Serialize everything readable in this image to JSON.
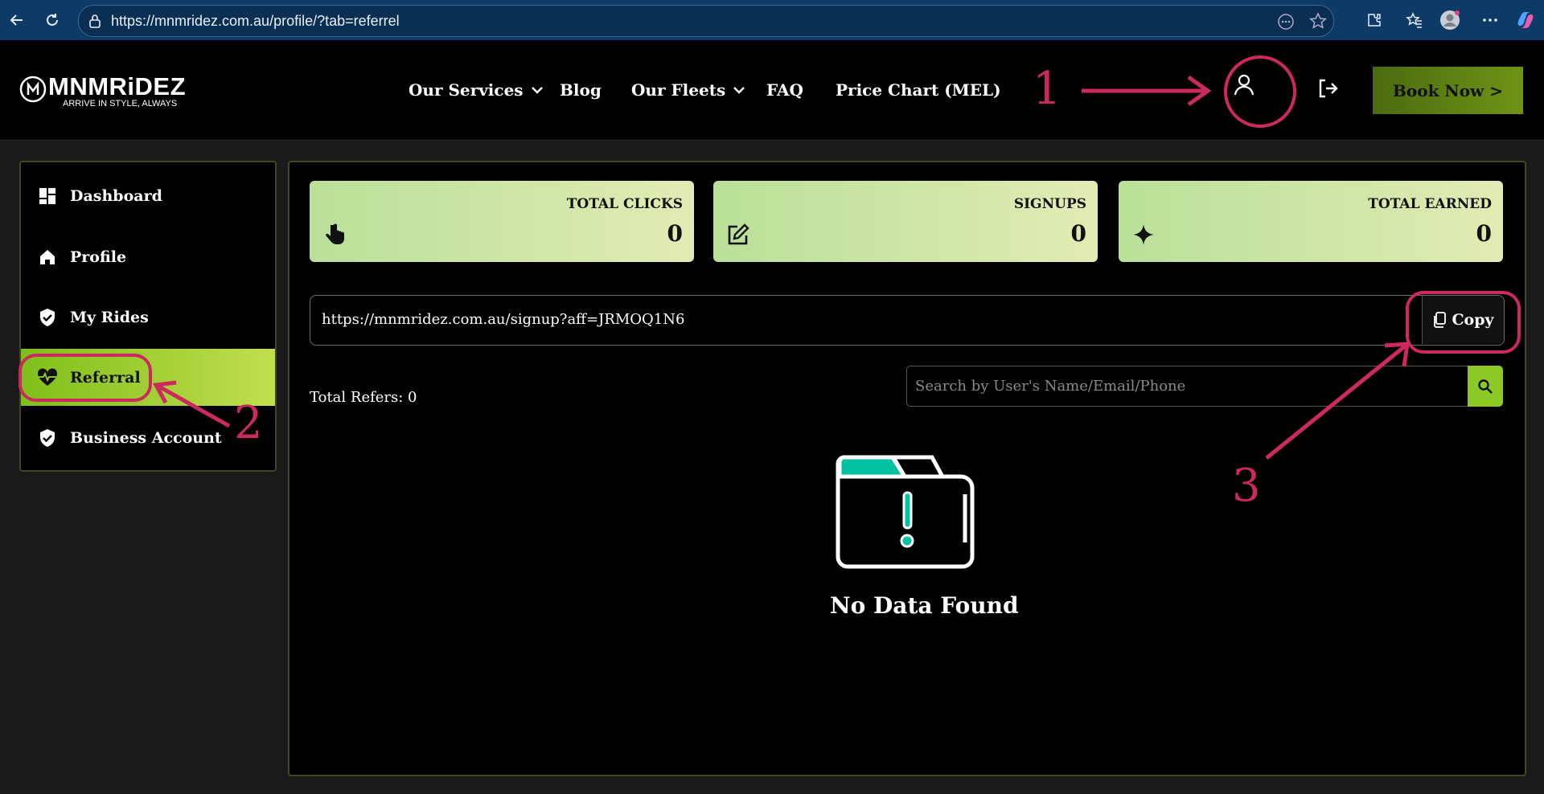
{
  "browser": {
    "url": "https://mnmridez.com.au/profile/?tab=referrel"
  },
  "header": {
    "logo_text": "MNMRiDEZ",
    "logo_tagline": "ARRIVE IN STYLE, ALWAYS",
    "menu": {
      "services": "Our Services",
      "blog": "Blog",
      "fleets": "Our Fleets",
      "faq": "FAQ",
      "price_chart": "Price Chart (MEL)"
    },
    "book_now": "Book Now >"
  },
  "sidebar": {
    "items": [
      {
        "label": "Dashboard",
        "icon": "dashboard-icon"
      },
      {
        "label": "Profile",
        "icon": "home-icon"
      },
      {
        "label": "My Rides",
        "icon": "shield-check-icon"
      },
      {
        "label": "Referral",
        "icon": "heart-pulse-icon",
        "active": true
      },
      {
        "label": "Business Account",
        "icon": "shield-check-icon"
      }
    ]
  },
  "stats": {
    "clicks": {
      "label": "TOTAL CLICKS",
      "value": "0",
      "icon": "pointer-hand-icon"
    },
    "signups": {
      "label": "SIGNUPS",
      "value": "0",
      "icon": "edit-icon"
    },
    "earned": {
      "label": "TOTAL EARNED",
      "value": "0",
      "icon": "sparkle-icon"
    }
  },
  "referral": {
    "link": "https://mnmridez.com.au/signup?aff=JRMOQ1N6",
    "copy_label": "Copy"
  },
  "refers": {
    "total_label": "Total Refers: 0",
    "search_placeholder": "Search by User's Name/Email/Phone"
  },
  "empty_state": {
    "message": "No Data Found"
  },
  "annotations": {
    "one": "1",
    "two": "2",
    "three": "3"
  },
  "colors": {
    "accent_green": "#8ac926",
    "annotation": "#cc2a5e",
    "empty_folder_tab": "#00c2a0"
  }
}
